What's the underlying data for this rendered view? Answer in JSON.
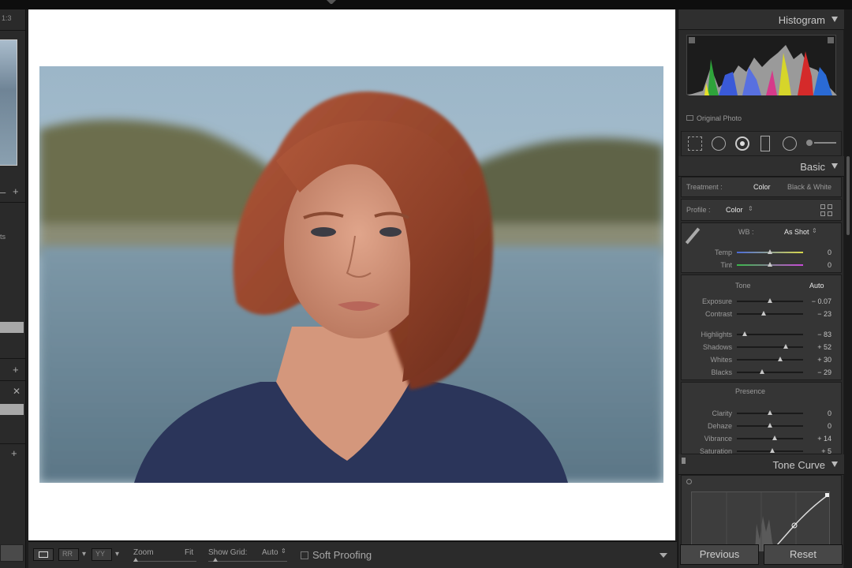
{
  "left_panel": {
    "zoom_ratio": "1:3",
    "fragment": "ts"
  },
  "toolbar": {
    "zoom_label": "Zoom",
    "fit_label": "Fit",
    "grid_label": "Show Grid:",
    "grid_value": "Auto",
    "soft_proofing": "Soft Proofing"
  },
  "right_panel": {
    "histogram": {
      "title": "Histogram",
      "original_photo": "Original Photo"
    },
    "basic": {
      "title": "Basic",
      "treatment_label": "Treatment :",
      "treatment_color": "Color",
      "treatment_bw": "Black & White",
      "profile_label": "Profile :",
      "profile_value": "Color",
      "wb_label": "WB :",
      "wb_value": "As Shot",
      "temp": {
        "label": "Temp",
        "value": "0"
      },
      "tint": {
        "label": "Tint",
        "value": "0"
      },
      "tone_label": "Tone",
      "auto_label": "Auto",
      "tone": [
        {
          "label": "Exposure",
          "value": "− 0.07",
          "pos": 0.5
        },
        {
          "label": "Contrast",
          "value": "− 23",
          "pos": 0.41
        },
        {
          "label": "Highlights",
          "value": "− 83",
          "pos": 0.12
        },
        {
          "label": "Shadows",
          "value": "+ 52",
          "pos": 0.74
        },
        {
          "label": "Whites",
          "value": "+ 30",
          "pos": 0.66
        },
        {
          "label": "Blacks",
          "value": "− 29",
          "pos": 0.38
        }
      ],
      "presence_label": "Presence",
      "presence": [
        {
          "label": "Clarity",
          "value": "0",
          "pos": 0.5
        },
        {
          "label": "Dehaze",
          "value": "0",
          "pos": 0.5
        },
        {
          "label": "Vibrance",
          "value": "+ 14",
          "pos": 0.57
        },
        {
          "label": "Saturation",
          "value": "+ 5",
          "pos": 0.53
        }
      ]
    },
    "tone_curve": {
      "title": "Tone Curve"
    },
    "previous_label": "Previous",
    "reset_label": "Reset"
  },
  "colors": {
    "panel_bg": "#2a2a2a",
    "canvas_bg": "#ffffff",
    "accent_text": "#c8c8c8"
  }
}
